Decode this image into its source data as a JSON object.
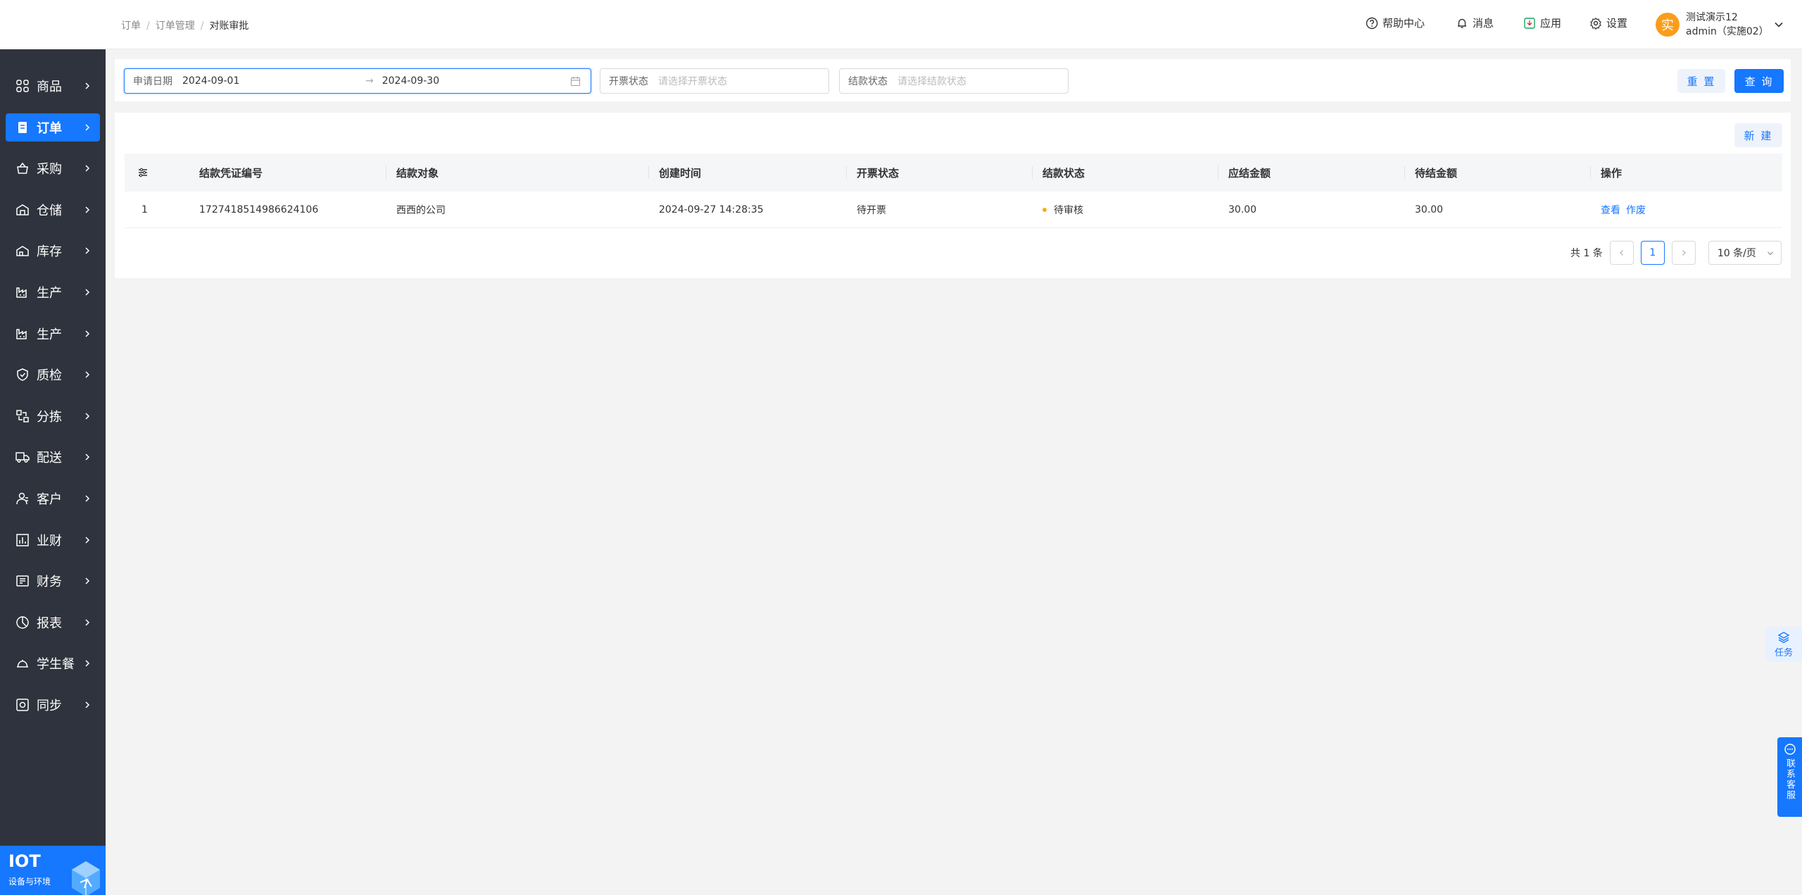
{
  "sidebar": {
    "items": [
      {
        "label": "商品",
        "icon": "grid-icon"
      },
      {
        "label": "订单",
        "icon": "order-icon",
        "active": true
      },
      {
        "label": "采购",
        "icon": "basket-icon"
      },
      {
        "label": "仓储",
        "icon": "warehouse-icon"
      },
      {
        "label": "库存",
        "icon": "stock-icon"
      },
      {
        "label": "生产",
        "icon": "factory-icon"
      },
      {
        "label": "生产",
        "icon": "factory-icon"
      },
      {
        "label": "质检",
        "icon": "shield-icon"
      },
      {
        "label": "分拣",
        "icon": "sort-icon"
      },
      {
        "label": "配送",
        "icon": "truck-icon"
      },
      {
        "label": "客户",
        "icon": "user-icon"
      },
      {
        "label": "业财",
        "icon": "bar-chart-icon"
      },
      {
        "label": "财务",
        "icon": "wallet-icon"
      },
      {
        "label": "报表",
        "icon": "pie-icon"
      },
      {
        "label": "学生餐",
        "icon": "dish-icon"
      },
      {
        "label": "同步",
        "icon": "sync-icon"
      }
    ],
    "iot": {
      "title": "IOT",
      "subtitle": "设备与环境"
    }
  },
  "header": {
    "breadcrumb": [
      "订单",
      "订单管理",
      "对账审批"
    ],
    "nav": {
      "help": "帮助中心",
      "messages": "消息",
      "apps": "应用",
      "settings": "设置"
    },
    "user": {
      "avatar_text": "实",
      "name": "测试演示12",
      "account": "admin（实施02）"
    }
  },
  "filters": {
    "date": {
      "label": "申请日期",
      "start": "2024-09-01",
      "end": "2024-09-30"
    },
    "invoice": {
      "label": "开票状态",
      "placeholder": "请选择开票状态"
    },
    "settle": {
      "label": "结款状态",
      "placeholder": "请选择结款状态"
    },
    "reset": "重 置",
    "query": "查 询"
  },
  "panel": {
    "new_button": "新 建"
  },
  "table": {
    "columns": [
      "结款凭证编号",
      "结款对象",
      "创建时间",
      "开票状态",
      "结款状态",
      "应结金额",
      "待结金额",
      "操作"
    ],
    "rows": [
      {
        "index": "1",
        "voucher": "1727418514986624106",
        "target": "西西的公司",
        "created": "2024-09-27 14:28:35",
        "invoice_status": "待开票",
        "settle_status": "待审核",
        "due": "30.00",
        "pending": "30.00",
        "actions": [
          "查看",
          "作废"
        ]
      }
    ]
  },
  "pagination": {
    "total": "共 1 条",
    "current": "1",
    "page_size": "10 条/页"
  },
  "floating": {
    "task": "任务",
    "support": "联系客服"
  },
  "colors": {
    "primary": "#1677ff",
    "sidebar": "#2f333d",
    "warning": "#faad14",
    "avatar": "#fa9d1a"
  }
}
